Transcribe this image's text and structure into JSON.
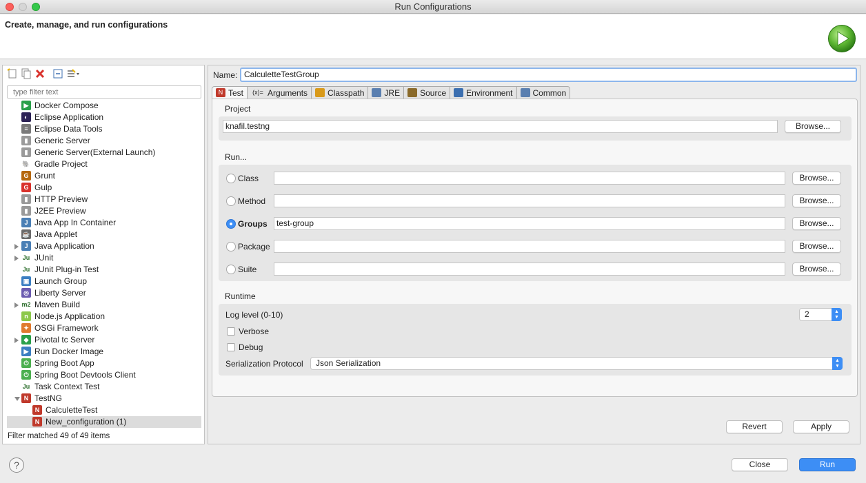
{
  "window": {
    "title": "Run Configurations"
  },
  "banner": {
    "title": "Create, manage, and run configurations"
  },
  "left": {
    "filter_placeholder": "type filter text",
    "filter_status": "Filter matched 49 of 49 items",
    "tree": [
      {
        "label": "Docker Compose",
        "icon": "docker-compose-icon",
        "color": "#2aa04a",
        "glyph": "▶",
        "level": 1
      },
      {
        "label": "Eclipse Application",
        "icon": "eclipse-icon",
        "color": "#2c2255",
        "glyph": "◐",
        "level": 1
      },
      {
        "label": "Eclipse Data Tools",
        "icon": "data-tools-icon",
        "color": "#7a7a7a",
        "glyph": "≡",
        "level": 1
      },
      {
        "label": "Generic Server",
        "icon": "server-icon",
        "color": "#9a9a9a",
        "glyph": "▮",
        "level": 1
      },
      {
        "label": "Generic Server(External Launch)",
        "icon": "server-icon",
        "color": "#9a9a9a",
        "glyph": "▮",
        "level": 1
      },
      {
        "label": "Gradle Project",
        "icon": "gradle-icon",
        "color": "#ffffff",
        "glyph": "🐘",
        "level": 1
      },
      {
        "label": "Grunt",
        "icon": "grunt-icon",
        "color": "#b5680f",
        "glyph": "G",
        "level": 1
      },
      {
        "label": "Gulp",
        "icon": "gulp-icon",
        "color": "#d9322c",
        "glyph": "G",
        "level": 1
      },
      {
        "label": "HTTP Preview",
        "icon": "server-icon",
        "color": "#9a9a9a",
        "glyph": "▮",
        "level": 1
      },
      {
        "label": "J2EE Preview",
        "icon": "server-icon",
        "color": "#9a9a9a",
        "glyph": "▮",
        "level": 1
      },
      {
        "label": "Java App In Container",
        "icon": "java-container-icon",
        "color": "#4a7fb5",
        "glyph": "J",
        "level": 1
      },
      {
        "label": "Java Applet",
        "icon": "applet-icon",
        "color": "#6a6a6a",
        "glyph": "☕",
        "level": 1
      },
      {
        "label": "Java Application",
        "icon": "java-app-icon",
        "color": "#4a7fb5",
        "glyph": "J",
        "level": 1,
        "twisty": "closed"
      },
      {
        "label": "JUnit",
        "icon": "junit-icon",
        "color": "#ffffff",
        "glyph": "Ju",
        "level": 1,
        "twisty": "closed"
      },
      {
        "label": "JUnit Plug-in Test",
        "icon": "junit-plugin-icon",
        "color": "#ffffff",
        "glyph": "Ju",
        "level": 1
      },
      {
        "label": "Launch Group",
        "icon": "launch-group-icon",
        "color": "#3c7fc2",
        "glyph": "▣",
        "level": 1
      },
      {
        "label": "Liberty Server",
        "icon": "liberty-icon",
        "color": "#6b5bb0",
        "glyph": "◎",
        "level": 1
      },
      {
        "label": "Maven Build",
        "icon": "maven-icon",
        "color": "#ffffff",
        "glyph": "m2",
        "level": 1,
        "twisty": "closed"
      },
      {
        "label": "Node.js Application",
        "icon": "nodejs-icon",
        "color": "#8cc84b",
        "glyph": "n",
        "level": 1
      },
      {
        "label": "OSGi Framework",
        "icon": "osgi-icon",
        "color": "#e07a2e",
        "glyph": "✦",
        "level": 1
      },
      {
        "label": "Pivotal tc Server",
        "icon": "pivotal-icon",
        "color": "#2aa04a",
        "glyph": "◆",
        "level": 1,
        "twisty": "closed"
      },
      {
        "label": "Run Docker Image",
        "icon": "docker-icon",
        "color": "#3c7fc2",
        "glyph": "▶",
        "level": 1
      },
      {
        "label": "Spring Boot App",
        "icon": "spring-icon",
        "color": "#4caf50",
        "glyph": "⏻",
        "level": 1
      },
      {
        "label": "Spring Boot Devtools Client",
        "icon": "spring-icon",
        "color": "#4caf50",
        "glyph": "⏻",
        "level": 1
      },
      {
        "label": "Task Context Test",
        "icon": "task-context-icon",
        "color": "#ffffff",
        "glyph": "Ju",
        "level": 1
      },
      {
        "label": "TestNG",
        "icon": "testng-icon",
        "color": "#c0392b",
        "glyph": "N",
        "level": 1,
        "twisty": "open"
      },
      {
        "label": "CalculetteTest",
        "icon": "testng-icon",
        "color": "#c0392b",
        "glyph": "N",
        "level": 2
      },
      {
        "label": "New_configuration (1)",
        "icon": "testng-icon",
        "color": "#c0392b",
        "glyph": "N",
        "level": 2,
        "selected": true
      }
    ]
  },
  "right": {
    "name_label": "Name:",
    "name_value": "CalculetteTestGroup",
    "tabs": [
      {
        "label": "Test",
        "icon": "testng-tab-icon",
        "active": true
      },
      {
        "label": "Arguments",
        "icon": "arguments-icon",
        "glyph": "(x)="
      },
      {
        "label": "Classpath",
        "icon": "classpath-icon"
      },
      {
        "label": "JRE",
        "icon": "jre-icon"
      },
      {
        "label": "Source",
        "icon": "source-icon"
      },
      {
        "label": "Environment",
        "icon": "environment-icon"
      },
      {
        "label": "Common",
        "icon": "common-icon"
      }
    ],
    "project": {
      "label": "Project",
      "value": "knafil.testng",
      "browse": "Browse..."
    },
    "run": {
      "label": "Run...",
      "options": [
        {
          "label": "Class",
          "value": "",
          "checked": false,
          "browse": "Browse..."
        },
        {
          "label": "Method",
          "value": "",
          "checked": false,
          "browse": "Browse..."
        },
        {
          "label": "Groups",
          "value": "test-group",
          "checked": true,
          "browse": "Browse..."
        },
        {
          "label": "Package",
          "value": "",
          "checked": false,
          "browse": "Browse..."
        },
        {
          "label": "Suite",
          "value": "",
          "checked": false,
          "browse": "Browse..."
        }
      ]
    },
    "runtime": {
      "label": "Runtime",
      "log_level_label": "Log level (0-10)",
      "log_level_value": "2",
      "verbose_label": "Verbose",
      "debug_label": "Debug",
      "serialization_label": "Serialization Protocol",
      "serialization_value": "Json Serialization"
    },
    "revert": "Revert",
    "apply": "Apply"
  },
  "footer": {
    "help": "?",
    "close": "Close",
    "run": "Run"
  },
  "colors": {
    "accent": "#3d8ef5",
    "selection": "#dcdcdc"
  }
}
